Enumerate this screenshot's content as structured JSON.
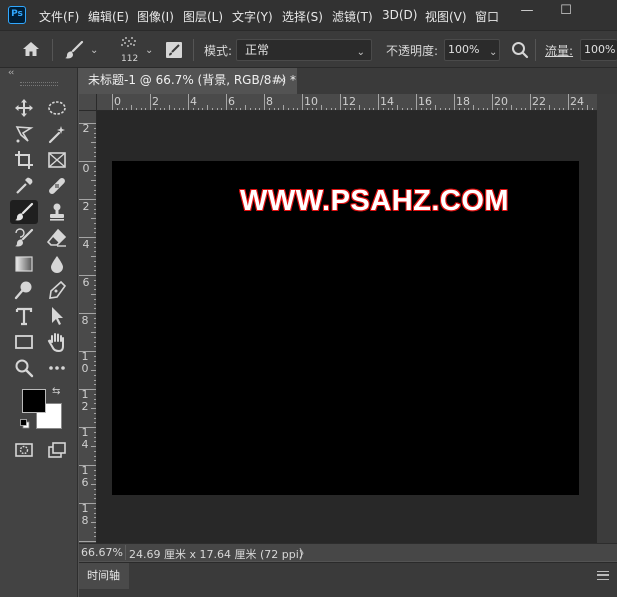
{
  "app": {
    "logo_text": "Ps",
    "accent": "#31a8ff"
  },
  "menu": {
    "items": [
      "文件(F)",
      "编辑(E)",
      "图像(I)",
      "图层(L)",
      "文字(Y)",
      "选择(S)",
      "滤镜(T)",
      "3D(D)",
      "视图(V)",
      "窗口"
    ],
    "window_controls": {
      "minimize": "—",
      "maximize": "☐"
    }
  },
  "options": {
    "brush_size": "112",
    "mode_label": "模式:",
    "mode_value": "正常",
    "opacity_label": "不透明度:",
    "opacity_value": "100%",
    "flow_label": "流量:",
    "flow_value": "100%"
  },
  "toolbar": {
    "collapse_label": "‹‹"
  },
  "document": {
    "tab_title": "未标题-1 @ 66.7% (背景, RGB/8#) *",
    "close_glyph": "×"
  },
  "ruler": {
    "top_labels": [
      "0",
      "2",
      "4",
      "6",
      "8",
      "10",
      "12",
      "14",
      "16",
      "18",
      "20",
      "22",
      "24"
    ],
    "left_labels": [
      "2",
      "0",
      "2",
      "4",
      "6",
      "8",
      "1 0",
      "1 2",
      "1 4",
      "1 6",
      "1 8"
    ]
  },
  "canvas": {
    "background": "#000000",
    "text": "WWW.PSAHZ.COM",
    "text_color": "#ffffff",
    "stroke_color": "#dd1111"
  },
  "status": {
    "zoom": "66.67%",
    "doc_info": "24.69 厘米 x 17.64 厘米 (72 ppi)",
    "arrow": "〉"
  },
  "timeline": {
    "tab_label": "时间轴"
  }
}
